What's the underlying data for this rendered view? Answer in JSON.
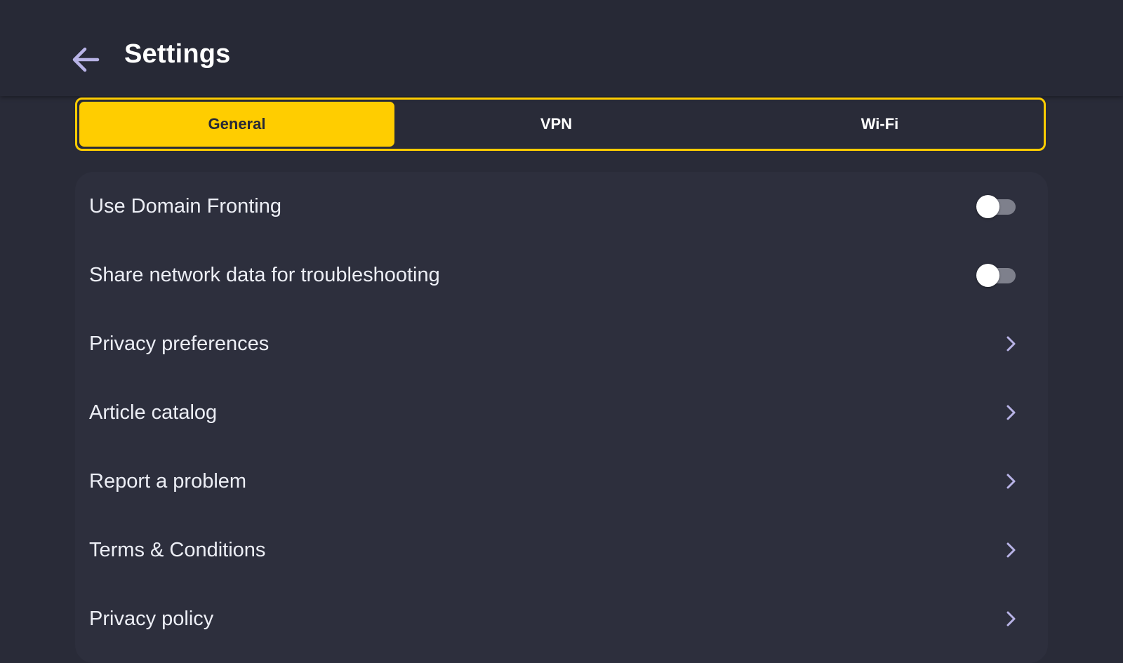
{
  "header": {
    "title": "Settings",
    "back_icon": "arrow-left-icon"
  },
  "tabs": [
    {
      "label": "General",
      "active": true
    },
    {
      "label": "VPN",
      "active": false
    },
    {
      "label": "Wi-Fi",
      "active": false
    }
  ],
  "settings": {
    "items": [
      {
        "label": "Use Domain Fronting",
        "control": "toggle",
        "enabled": false
      },
      {
        "label": "Share network data for troubleshooting",
        "control": "toggle",
        "enabled": false
      },
      {
        "label": "Privacy preferences",
        "control": "chevron-right-icon"
      },
      {
        "label": "Article catalog",
        "control": "chevron-right-icon"
      },
      {
        "label": "Report a problem",
        "control": "chevron-right-icon"
      },
      {
        "label": "Terms & Conditions",
        "control": "chevron-right-icon"
      },
      {
        "label": "Privacy policy",
        "control": "chevron-right-icon"
      }
    ]
  },
  "colors": {
    "background": "#292b38",
    "header": "#272936",
    "card": "#2d2f3d",
    "accent": "#ffcd00",
    "icon": "#b8b3e6"
  }
}
